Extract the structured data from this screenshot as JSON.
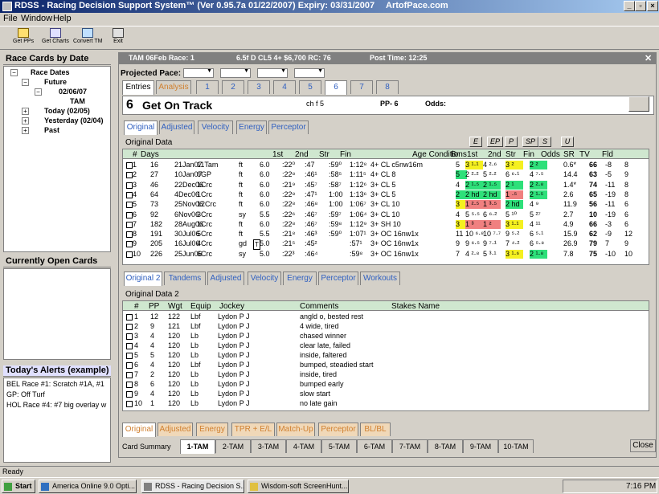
{
  "window": {
    "title": "RDSS - Racing Decision Support System™ (Ver 0.95.7a  01/22/2007)  Expiry: 03/31/2007",
    "site": "ArtofPace.com"
  },
  "menu": [
    "File",
    "Window",
    "Help"
  ],
  "toolbar": [
    {
      "label": "Get PPs"
    },
    {
      "label": "Get Charts"
    },
    {
      "label": "Convert TM"
    },
    {
      "label": "Exit"
    }
  ],
  "left": {
    "race_cards_header": "Race Cards by Date",
    "tree": {
      "root": "Race Dates",
      "future": "Future",
      "date": "02/06/07",
      "track": "TAM",
      "today": "Today (02/05)",
      "yesterday": "Yesterday (02/04)",
      "past": "Past"
    },
    "open_cards_header": "Currently Open Cards",
    "alerts_header": "Today's Alerts (example)",
    "alerts": [
      "BEL Race #1: Scratch #1A, #1",
      "GP: Off Turf",
      "HOL Race #4: #7 big overlay w"
    ]
  },
  "card": {
    "title": "TAM 06Feb Race: 1",
    "details": "6.5f  D  CL5  4+  $6,700  RC: 76",
    "post_time": "Post Time: 12:25",
    "projected_pace_label": "Projected Pace:",
    "top_tabs": [
      "Entries",
      "Analysis",
      "1",
      "2",
      "3",
      "4",
      "5",
      "6",
      "7",
      "8"
    ],
    "horse_num": "6",
    "horse_name": "Get On Track",
    "horse_desc": "ch f 5",
    "pp": "PP- 6",
    "odds_label": "Odds:",
    "pp_tabs": [
      "Original",
      "Adjusted",
      "Velocity",
      "Energy",
      "Perceptor"
    ],
    "section1": "Original Data",
    "filter_buttons": [
      "E",
      "EP",
      "P",
      "SP",
      "S",
      "U"
    ],
    "cols1": [
      "#",
      "Days",
      "",
      "",
      "",
      "1st",
      "2nd",
      "Str",
      "Fin",
      "Age Conditions",
      "Br",
      "1st",
      "2nd",
      "Str",
      "Fin",
      "Odds",
      "SR",
      "TV",
      "Fld"
    ],
    "rows1": [
      [
        "1",
        "16",
        "21Jan07",
        "11Tam",
        "ft",
        "6.0",
        ":22⁰",
        ":47",
        ":59⁰",
        "1:12⁸",
        "4+ CL c5nw16m",
        "5",
        "3 ¹·¹",
        "4 ²·⁶",
        "3 ²",
        "2 ²",
        "0.6*",
        "66",
        "-8",
        "8"
      ],
      [
        "2",
        "27",
        "10Jan07",
        "6GP",
        "ft",
        "6.0",
        ":22⁸",
        ":46¹",
        ":58⁵",
        "1:11⁵",
        "4+ CL 8",
        "5",
        "2 ²·²",
        "5 ²·²",
        "6 ⁶·¹",
        "4 ⁷·⁵",
        "14.4",
        "63",
        "-5",
        "9"
      ],
      [
        "3",
        "46",
        "22Dec06",
        "1Crc",
        "ft",
        "6.0",
        ":21⁹",
        ":45⁷",
        ":58⁷",
        "1:12⁶",
        "3+ CL 5",
        "4",
        "2 ¹·⁵",
        "2 ¹·⁵",
        "2 ¹",
        "2 ²·⁸",
        "1.4*",
        "74",
        "-11",
        "8"
      ],
      [
        "4",
        "64",
        "4Dec06",
        "1Crc",
        "ft",
        "6.0",
        ":22⁸",
        ":47¹",
        "1:00",
        "1:13⁶",
        "3+ CL 5",
        "2",
        "2 hd",
        "2 hd",
        "1 ·⁵",
        "2 ¹·⁵",
        "2.6",
        "65",
        "-19",
        "8"
      ],
      [
        "5",
        "73",
        "25Nov06",
        "12Crc",
        "ft",
        "6.0",
        ":22⁸",
        ":46⁸",
        "1:00",
        "1:06⁷",
        "3+ CL 10",
        "3",
        "1 ²·⁵",
        "1 ³·⁵",
        "2 hd",
        "4 ⁹",
        "11.9",
        "56",
        "-11",
        "6"
      ],
      [
        "6",
        "92",
        "6Nov06",
        "3Crc",
        "sy",
        "5.5",
        ":22⁶",
        ":46⁷",
        ":59⁷",
        "1:06⁴",
        "3+ CL 10",
        "4",
        "5 ⁵·⁵",
        "6 ⁶·²",
        "5 ¹⁰",
        "5 ²⁷",
        "2.7",
        "10",
        "-19",
        "6"
      ],
      [
        "7",
        "182",
        "28Aug06",
        "1Crc",
        "ft",
        "6.0",
        ":22⁸",
        ":46⁷",
        ":59⁸",
        "1:12⁹",
        "3+ SH 10",
        "3",
        "1 ³",
        "1 ²",
        "3 ¹·¹",
        "4 ¹¹",
        "4.9",
        "66",
        "-3",
        "6"
      ],
      [
        "8",
        "191",
        "30Jul06",
        "5Crc",
        "ft",
        "5.5",
        ":21⁸",
        ":46³",
        ":59⁰",
        "1:07¹",
        "3+ OC 16nw1x",
        "11",
        "10 ⁶·⁸",
        "10 ⁷·⁷",
        "9 ⁵·²",
        "6 ⁵·¹",
        "15.9",
        "62",
        "-9",
        "12"
      ],
      [
        "9",
        "205",
        "16Jul06",
        "4Crc",
        "gd",
        "5.0",
        ":21⁵",
        ":45²",
        "",
        ":57¹",
        "3+ OC 16nw1x",
        "9",
        "9 ⁶·⁵",
        "9 ⁷·¹",
        "7 ⁴·²",
        "6 ⁵·⁸",
        "26.9",
        "79",
        "7",
        "9"
      ],
      [
        "10",
        "226",
        "25Jun06",
        "6Crc",
        "sy",
        "5.0",
        ":22³",
        ":46⁴",
        "",
        ":59⁸",
        "3+ OC 16nw1x",
        "7",
        "4 ²·⁸",
        "5 ³·¹",
        "3 ¹·⁶",
        "2 ¹·⁸",
        "7.8",
        "75",
        "-10",
        "10"
      ]
    ],
    "row9_flag": "T",
    "od2_tabs": [
      "Original 2",
      "Tandems",
      "Adjusted",
      "Velocity",
      "Energy",
      "Perceptor",
      "Workouts"
    ],
    "section2": "Original Data 2",
    "cols2": [
      "#",
      "PP",
      "Wgt",
      "Equip",
      "Jockey",
      "Comments",
      "Stakes Name"
    ],
    "rows2": [
      [
        "1",
        "12",
        "122",
        "Lbf",
        "Lydon P J",
        "angld o, bested rest"
      ],
      [
        "2",
        "9",
        "121",
        "Lbf",
        "Lydon P J",
        "4 wide, tired"
      ],
      [
        "3",
        "4",
        "120",
        "Lb",
        "Lydon P J",
        "chased winner"
      ],
      [
        "4",
        "4",
        "120",
        "Lb",
        "Lydon P J",
        "clear late, failed"
      ],
      [
        "5",
        "5",
        "120",
        "Lb",
        "Lydon P J",
        "inside, faltered"
      ],
      [
        "6",
        "4",
        "120",
        "Lbf",
        "Lydon P J",
        "bumped, steadied start"
      ],
      [
        "7",
        "2",
        "120",
        "Lb",
        "Lydon P J",
        "inside, tired"
      ],
      [
        "8",
        "6",
        "120",
        "Lb",
        "Lydon P J",
        "bumped early"
      ],
      [
        "9",
        "4",
        "120",
        "Lb",
        "Lydon P J",
        "slow start"
      ],
      [
        "10",
        "1",
        "120",
        "Lb",
        "Lydon P J",
        "no late gain"
      ]
    ],
    "bottom_tabs": [
      "Original",
      "Adjusted",
      "Energy",
      "TPR + E/L",
      "Match-Up",
      "Perceptor",
      "BL/BL"
    ],
    "summary_label": "Card Summary",
    "race_tabs": [
      "1-TAM",
      "2-TAM",
      "3-TAM",
      "4-TAM",
      "5-TAM",
      "6-TAM",
      "7-TAM",
      "8-TAM",
      "9-TAM",
      "10-TAM"
    ],
    "close": "Close"
  },
  "status": "Ready",
  "taskbar": {
    "start": "Start",
    "tasks": [
      "America Online 9.0 Opti...",
      "RDSS - Racing Decision S...",
      "Wisdom-soft ScreenHunt..."
    ],
    "clock": "7:16 PM"
  },
  "colors": {
    "green": "#2ee07a",
    "yellow": "#f5f020",
    "red": "#f08080"
  }
}
